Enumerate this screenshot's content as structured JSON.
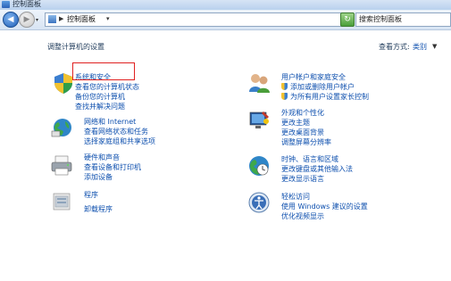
{
  "window": {
    "title": "控制面板"
  },
  "nav": {
    "back_arrow": "◀",
    "forward_arrow": "▶",
    "history_dropdown": "▾"
  },
  "address": {
    "separator": "▶",
    "crumb": "控制面板",
    "crumb_dropdown": "▾",
    "dropdown": "▾"
  },
  "refresh": {
    "glyph": "↻"
  },
  "search": {
    "placeholder": "搜索控制面板"
  },
  "main": {
    "heading": "调整计算机的设置",
    "view_by_label": "查看方式:",
    "view_by_value": "类别",
    "view_by_dropdown": "▼"
  },
  "categories": {
    "system": {
      "title": "系统和安全",
      "links": [
        "查看您的计算机状态",
        "备份您的计算机",
        "查找并解决问题"
      ]
    },
    "network": {
      "title": "网络和 Internet",
      "links": [
        "查看网络状态和任务",
        "选择家庭组和共享选项"
      ]
    },
    "hardware": {
      "title": "硬件和声音",
      "links": [
        "查看设备和打印机",
        "添加设备"
      ]
    },
    "programs": {
      "title": "程序",
      "links": [
        "卸载程序"
      ]
    },
    "users": {
      "title": "用户帐户和家庭安全",
      "links": [
        "添加或删除用户帐户",
        "为所有用户设置家长控制"
      ]
    },
    "appearance": {
      "title": "外观和个性化",
      "links": [
        "更改主题",
        "更改桌面背景",
        "调整屏幕分辨率"
      ]
    },
    "clock": {
      "title": "时钟、语言和区域",
      "links": [
        "更改键盘或其他输入法",
        "更改显示语言"
      ]
    },
    "ease": {
      "title": "轻松访问",
      "links": [
        "使用 Windows 建议的设置",
        "优化视频显示"
      ]
    }
  }
}
